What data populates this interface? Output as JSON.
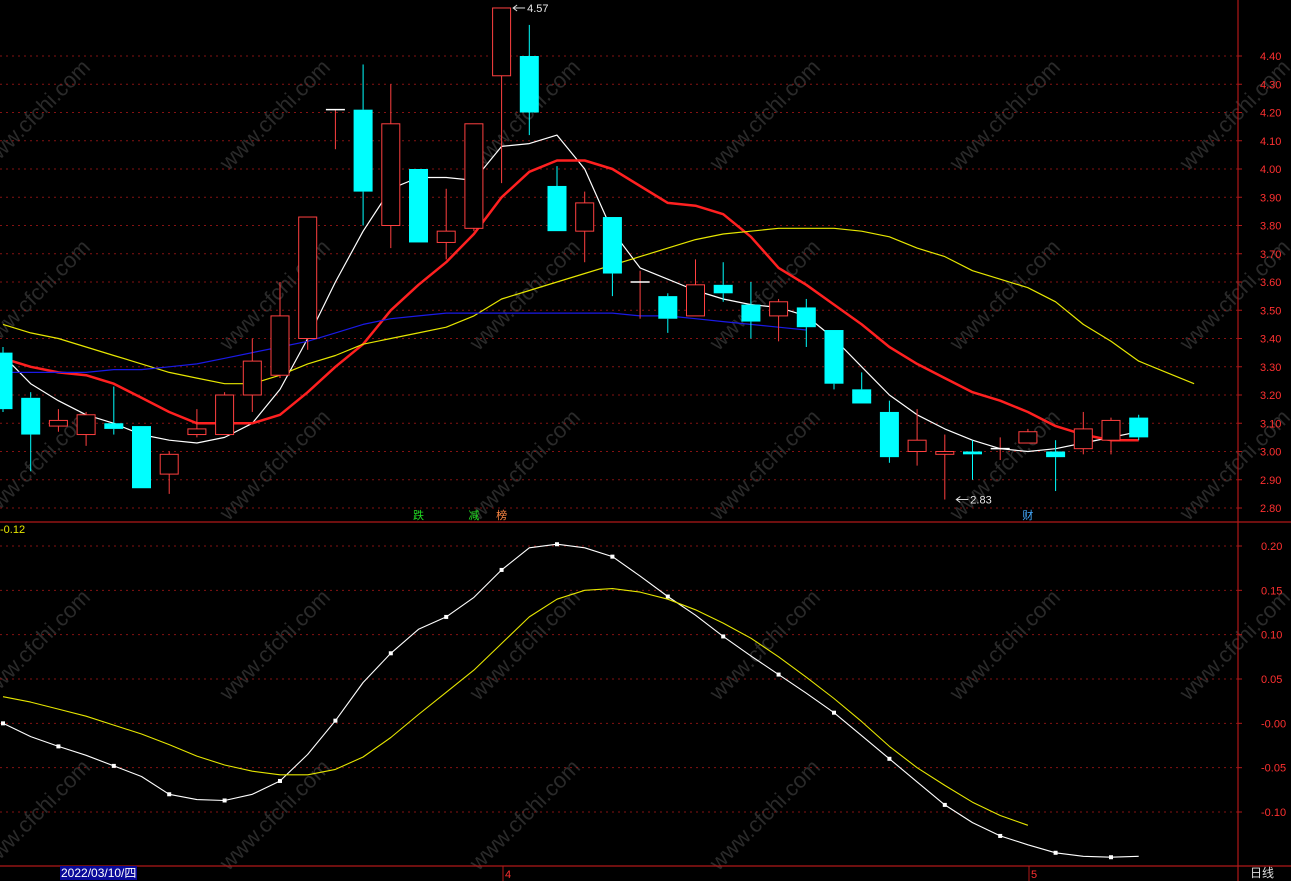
{
  "chart_data": [
    {
      "type": "candlestick",
      "title": "",
      "ylim": [
        2.76,
        4.58
      ],
      "y_ticks": [
        "4.40",
        "4.30",
        "4.20",
        "4.10",
        "4.00",
        "3.90",
        "3.80",
        "3.70",
        "3.60",
        "3.50",
        "3.40",
        "3.30",
        "3.20",
        "3.10",
        "3.00",
        "2.90",
        "2.80"
      ],
      "candles": [
        {
          "o": 3.35,
          "c": 3.15,
          "h": 3.37,
          "l": 3.14
        },
        {
          "o": 3.19,
          "c": 3.06,
          "h": 3.21,
          "l": 2.93
        },
        {
          "o": 3.09,
          "c": 3.11,
          "h": 3.15,
          "l": 3.07
        },
        {
          "o": 3.06,
          "c": 3.13,
          "h": 3.14,
          "l": 3.02
        },
        {
          "o": 3.1,
          "c": 3.08,
          "h": 3.23,
          "l": 3.06
        },
        {
          "o": 3.09,
          "c": 2.87,
          "h": 3.09,
          "l": 2.87
        },
        {
          "o": 2.92,
          "c": 2.99,
          "h": 3.0,
          "l": 2.85
        },
        {
          "o": 3.06,
          "c": 3.08,
          "h": 3.15,
          "l": 3.05
        },
        {
          "o": 3.06,
          "c": 3.2,
          "h": 3.21,
          "l": 3.06
        },
        {
          "o": 3.2,
          "c": 3.32,
          "h": 3.4,
          "l": 3.14
        },
        {
          "o": 3.27,
          "c": 3.48,
          "h": 3.6,
          "l": 3.26
        },
        {
          "o": 3.4,
          "c": 3.83,
          "h": 3.83,
          "l": 3.36
        },
        {
          "o": 4.21,
          "c": 4.21,
          "h": 4.21,
          "l": 4.07
        },
        {
          "o": 4.21,
          "c": 3.92,
          "h": 4.37,
          "l": 3.8
        },
        {
          "o": 3.8,
          "c": 4.16,
          "h": 4.3,
          "l": 3.72
        },
        {
          "o": 4.0,
          "c": 3.74,
          "h": 4.0,
          "l": 3.74
        },
        {
          "o": 3.74,
          "c": 3.78,
          "h": 3.93,
          "l": 3.68
        },
        {
          "o": 3.79,
          "c": 4.16,
          "h": 4.16,
          "l": 3.78
        },
        {
          "o": 4.33,
          "c": 4.57,
          "h": 4.57,
          "l": 3.95
        },
        {
          "o": 4.4,
          "c": 4.2,
          "h": 4.51,
          "l": 4.12
        },
        {
          "o": 3.94,
          "c": 3.78,
          "h": 4.01,
          "l": 3.78
        },
        {
          "o": 3.78,
          "c": 3.88,
          "h": 3.92,
          "l": 3.67
        },
        {
          "o": 3.83,
          "c": 3.63,
          "h": 3.83,
          "l": 3.55
        },
        {
          "o": 3.6,
          "c": 3.6,
          "h": 3.64,
          "l": 3.47
        },
        {
          "o": 3.55,
          "c": 3.47,
          "h": 3.56,
          "l": 3.42
        },
        {
          "o": 3.48,
          "c": 3.59,
          "h": 3.68,
          "l": 3.48
        },
        {
          "o": 3.59,
          "c": 3.56,
          "h": 3.67,
          "l": 3.53
        },
        {
          "o": 3.52,
          "c": 3.46,
          "h": 3.6,
          "l": 3.4
        },
        {
          "o": 3.48,
          "c": 3.53,
          "h": 3.54,
          "l": 3.39
        },
        {
          "o": 3.51,
          "c": 3.44,
          "h": 3.54,
          "l": 3.37
        },
        {
          "o": 3.43,
          "c": 3.24,
          "h": 3.43,
          "l": 3.22
        },
        {
          "o": 3.22,
          "c": 3.17,
          "h": 3.28,
          "l": 3.17
        },
        {
          "o": 3.14,
          "c": 2.98,
          "h": 3.18,
          "l": 2.96
        },
        {
          "o": 3.0,
          "c": 3.04,
          "h": 3.15,
          "l": 2.95
        },
        {
          "o": 2.99,
          "c": 3.0,
          "h": 3.06,
          "l": 2.83
        },
        {
          "o": 3.0,
          "c": 2.99,
          "h": 3.04,
          "l": 2.9
        },
        {
          "o": 3.01,
          "c": 3.01,
          "h": 3.05,
          "l": 2.97
        },
        {
          "o": 3.03,
          "c": 3.07,
          "h": 3.08,
          "l": 3.03
        },
        {
          "o": 3.0,
          "c": 2.98,
          "h": 3.04,
          "l": 2.86
        },
        {
          "o": 3.01,
          "c": 3.08,
          "h": 3.14,
          "l": 2.99
        },
        {
          "o": 3.04,
          "c": 3.11,
          "h": 3.12,
          "l": 2.99
        },
        {
          "o": 3.12,
          "c": 3.05,
          "h": 3.13,
          "l": 3.04
        }
      ],
      "series": [
        {
          "color": "#ffffff",
          "values": [
            3.34,
            3.24,
            3.18,
            3.13,
            3.1,
            3.06,
            3.04,
            3.03,
            3.05,
            3.1,
            3.22,
            3.4,
            3.6,
            3.78,
            3.93,
            3.97,
            3.97,
            3.96,
            4.08,
            4.09,
            4.12,
            4.0,
            3.78,
            3.65,
            3.61,
            3.57,
            3.54,
            3.52,
            3.51,
            3.48,
            3.4,
            3.3,
            3.2,
            3.13,
            3.08,
            3.04,
            3.01,
            3.0,
            3.01,
            3.03,
            3.05,
            3.07
          ]
        },
        {
          "color": "#ff2020",
          "values": [
            3.33,
            3.3,
            3.28,
            3.27,
            3.24,
            3.19,
            3.14,
            3.1,
            3.1,
            3.1,
            3.13,
            3.21,
            3.3,
            3.38,
            3.5,
            3.59,
            3.67,
            3.77,
            3.9,
            3.99,
            4.03,
            4.03,
            4.0,
            3.94,
            3.88,
            3.87,
            3.84,
            3.76,
            3.65,
            3.59,
            3.52,
            3.45,
            3.37,
            3.31,
            3.26,
            3.21,
            3.18,
            3.14,
            3.09,
            3.06,
            3.04,
            3.04
          ]
        },
        {
          "color": "#e6e600",
          "values": [
            3.45,
            3.42,
            3.4,
            3.37,
            3.34,
            3.31,
            3.28,
            3.26,
            3.24,
            3.24,
            3.27,
            3.31,
            3.34,
            3.38,
            3.4,
            3.42,
            3.44,
            3.48,
            3.54,
            3.57,
            3.6,
            3.63,
            3.66,
            3.69,
            3.72,
            3.75,
            3.77,
            3.78,
            3.79,
            3.79,
            3.79,
            3.78,
            3.76,
            3.72,
            3.69,
            3.64,
            3.61,
            3.58,
            3.53,
            3.45,
            3.39,
            3.32,
            3.28,
            3.24
          ]
        },
        {
          "color": "#1a1ae6",
          "values": [
            3.28,
            3.28,
            3.28,
            3.28,
            3.29,
            3.29,
            3.3,
            3.31,
            3.33,
            3.35,
            3.37,
            3.39,
            3.42,
            3.45,
            3.47,
            3.48,
            3.49,
            3.49,
            3.49,
            3.49,
            3.49,
            3.49,
            3.49,
            3.48,
            3.48,
            3.47,
            3.46,
            3.45,
            3.44,
            3.43
          ]
        }
      ],
      "annotations": [
        {
          "text": "4.57",
          "index": 18,
          "price": 4.57
        },
        {
          "text": "2.83",
          "index": 34,
          "price": 2.83
        }
      ],
      "event_labels": [
        {
          "text": "跌",
          "index": 15,
          "color": "#22dd22"
        },
        {
          "text": "减",
          "index": 17,
          "color": "#22dd22"
        },
        {
          "text": "榜",
          "index": 18,
          "color": "#ff8844"
        },
        {
          "text": "财",
          "index": 37,
          "color": "#44aaff"
        }
      ]
    },
    {
      "type": "line",
      "title": "",
      "value_label": "-0.12",
      "ylim": [
        -0.155,
        0.215
      ],
      "y_ticks": [
        "0.20",
        "0.15",
        "0.10",
        "0.05",
        "-0.00",
        "-0.05",
        "-0.10"
      ],
      "series": [
        {
          "color": "#ffffff",
          "markers": true,
          "values": [
            0.0,
            -0.015,
            -0.026,
            -0.036,
            -0.048,
            -0.06,
            -0.08,
            -0.086,
            -0.087,
            -0.08,
            -0.065,
            -0.035,
            0.003,
            0.046,
            0.079,
            0.106,
            0.12,
            0.142,
            0.173,
            0.198,
            0.202,
            0.198,
            0.188,
            0.166,
            0.143,
            0.122,
            0.098,
            0.076,
            0.055,
            0.034,
            0.012,
            -0.014,
            -0.04,
            -0.066,
            -0.092,
            -0.112,
            -0.127,
            -0.137,
            -0.146,
            -0.15,
            -0.151,
            -0.15
          ]
        },
        {
          "color": "#e6e600",
          "markers": false,
          "values": [
            0.03,
            0.024,
            0.016,
            0.008,
            -0.002,
            -0.012,
            -0.024,
            -0.037,
            -0.047,
            -0.054,
            -0.058,
            -0.058,
            -0.052,
            -0.038,
            -0.016,
            0.01,
            0.035,
            0.06,
            0.09,
            0.12,
            0.14,
            0.15,
            0.152,
            0.148,
            0.14,
            0.128,
            0.113,
            0.096,
            0.075,
            0.052,
            0.028,
            0.002,
            -0.026,
            -0.05,
            -0.07,
            -0.089,
            -0.104,
            -0.115
          ]
        }
      ]
    }
  ],
  "x_labels": {
    "date": "2022/03/10/四",
    "m4": "4",
    "m5": "5"
  },
  "period": "日线",
  "watermark": "www.cfchi.com",
  "colors": {
    "up": "#ff4040",
    "down": "#00ffff",
    "grid": "#b01818",
    "axis_text": "#ff3030"
  }
}
